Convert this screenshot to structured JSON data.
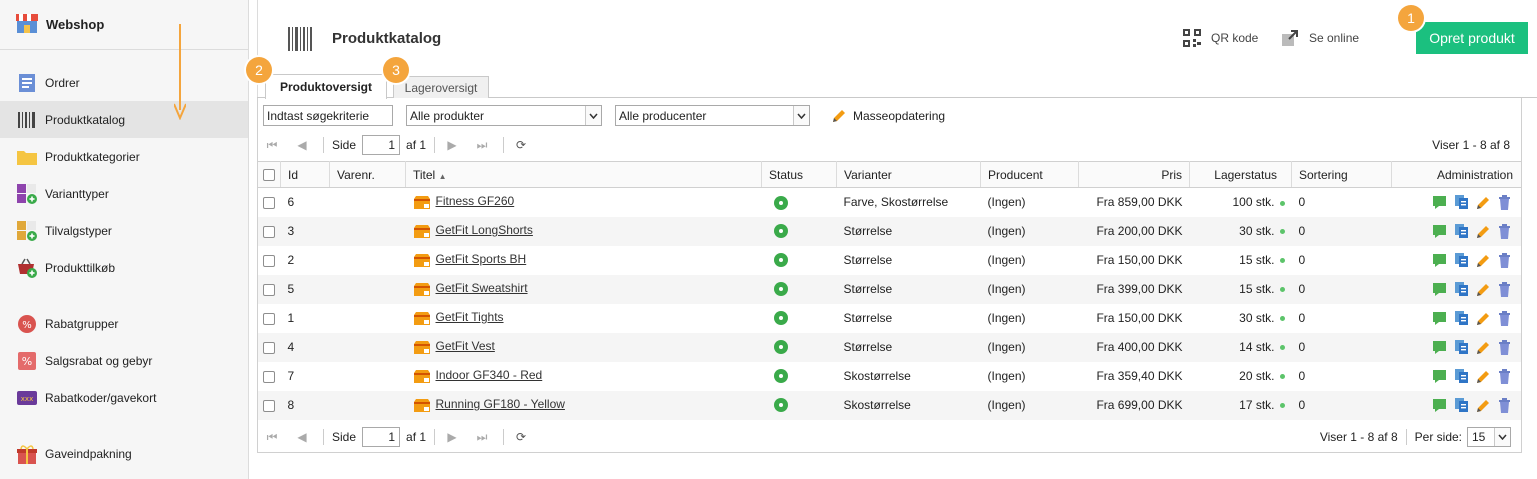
{
  "sidebar": {
    "title": "Webshop",
    "items": [
      {
        "label": "Ordrer",
        "icon": "orders-icon"
      },
      {
        "label": "Produktkatalog",
        "icon": "barcode-icon"
      },
      {
        "label": "Produktkategorier",
        "icon": "folder-icon"
      },
      {
        "label": "Varianttyper",
        "icon": "variant-types-icon"
      },
      {
        "label": "Tilvalgstyper",
        "icon": "option-types-icon"
      },
      {
        "label": "Produkttilkøb",
        "icon": "basket-add-icon"
      },
      {
        "label": "Rabatgrupper",
        "icon": "discount-group-icon"
      },
      {
        "label": "Salgsrabat og gebyr",
        "icon": "percent-icon"
      },
      {
        "label": "Rabatkoder/gavekort",
        "icon": "voucher-icon"
      },
      {
        "label": "Gaveindpakning",
        "icon": "gift-icon"
      }
    ]
  },
  "header": {
    "title": "Produktkatalog",
    "qr_label": "QR kode",
    "online_label": "Se online",
    "create_label": "Opret produkt"
  },
  "badges": {
    "one": "1",
    "two": "2",
    "three": "3"
  },
  "tabs": [
    {
      "label": "Produktoversigt",
      "active": true
    },
    {
      "label": "Lageroversigt",
      "active": false
    }
  ],
  "filters": {
    "search_value": "Indtast søgekriterie",
    "products_select": "Alle produkter",
    "producers_select": "Alle producenter",
    "mass_update_label": "Masseopdatering"
  },
  "pager": {
    "side_label": "Side",
    "page_value": "1",
    "of_label": "af 1",
    "showing": "Viser 1 - 8 af 8",
    "per_page_label": "Per side:",
    "per_page_value": "15"
  },
  "columns": [
    "Id",
    "Varenr.",
    "Titel",
    "Status",
    "Varianter",
    "Producent",
    "Pris",
    "Lagerstatus",
    "Sortering",
    "Administration"
  ],
  "rows": [
    {
      "id": "6",
      "varenr": "",
      "title": "Fitness GF260",
      "variants": "Farve, Skostørrelse",
      "producer": "(Ingen)",
      "price": "Fra 859,00 DKK",
      "stock": "100 stk.",
      "sort": "0"
    },
    {
      "id": "3",
      "varenr": "",
      "title": "GetFit LongShorts",
      "variants": "Størrelse",
      "producer": "(Ingen)",
      "price": "Fra 200,00 DKK",
      "stock": "30 stk.",
      "sort": "0"
    },
    {
      "id": "2",
      "varenr": "",
      "title": "GetFit Sports BH",
      "variants": "Størrelse",
      "producer": "(Ingen)",
      "price": "Fra 150,00 DKK",
      "stock": "15 stk.",
      "sort": "0"
    },
    {
      "id": "5",
      "varenr": "",
      "title": "GetFit Sweatshirt",
      "variants": "Størrelse",
      "producer": "(Ingen)",
      "price": "Fra 399,00 DKK",
      "stock": "15 stk.",
      "sort": "0"
    },
    {
      "id": "1",
      "varenr": "",
      "title": "GetFit Tights",
      "variants": "Størrelse",
      "producer": "(Ingen)",
      "price": "Fra 150,00 DKK",
      "stock": "30 stk.",
      "sort": "0"
    },
    {
      "id": "4",
      "varenr": "",
      "title": "GetFit Vest",
      "variants": "Størrelse",
      "producer": "(Ingen)",
      "price": "Fra 400,00 DKK",
      "stock": "14 stk.",
      "sort": "0"
    },
    {
      "id": "7",
      "varenr": "",
      "title": "Indoor GF340 - Red",
      "variants": "Skostørrelse",
      "producer": "(Ingen)",
      "price": "Fra 359,40 DKK",
      "stock": "20 stk.",
      "sort": "0"
    },
    {
      "id": "8",
      "varenr": "",
      "title": "Running GF180 - Yellow",
      "variants": "Skostørrelse",
      "producer": "(Ingen)",
      "price": "Fra 699,00 DKK",
      "stock": "17 stk.",
      "sort": "0"
    }
  ],
  "colors": {
    "accent": "#1bc07f",
    "badge": "#f4a53d",
    "status_active": "#3aaa4a",
    "arrow": "#f4a53d"
  }
}
